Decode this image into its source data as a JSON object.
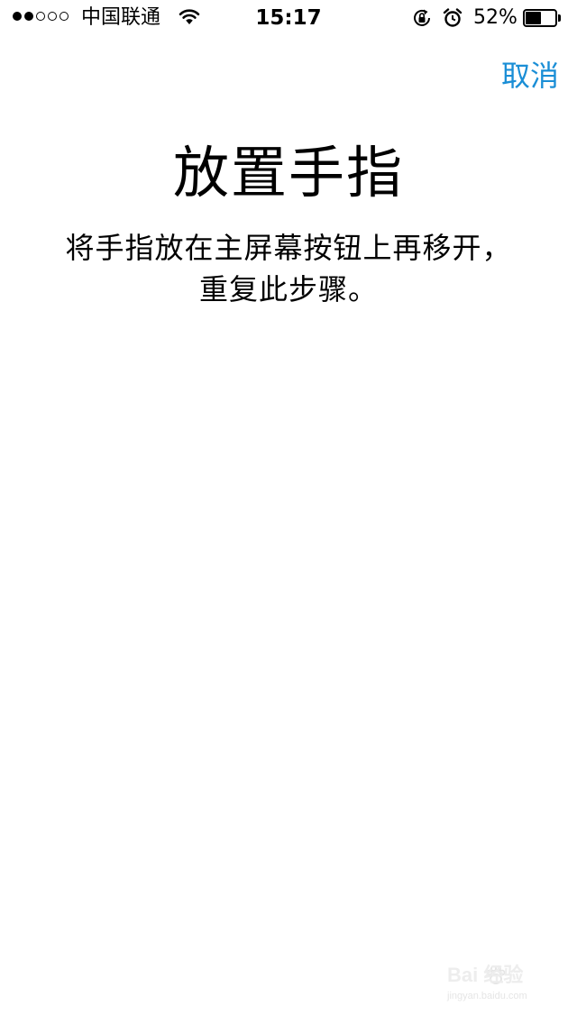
{
  "status_bar": {
    "signal_strength": 2,
    "signal_max": 5,
    "carrier": "中国联通",
    "wifi_icon": "wifi-icon",
    "time": "15:17",
    "rotation_lock_icon": "rotation-lock-icon",
    "alarm_icon": "alarm-icon",
    "battery_percent": "52%",
    "battery_level": 0.52
  },
  "nav": {
    "cancel_label": "取消"
  },
  "main": {
    "title": "放置手指",
    "instruction": "将手指放在主屏幕按钮上再移开，重复此步骤。"
  },
  "watermark": {
    "logo_text": "Bai  经验",
    "url": "jingyan.baidu.com"
  },
  "colors": {
    "accent": "#1a8ed6",
    "background": "#ffffff",
    "text": "#000000"
  }
}
